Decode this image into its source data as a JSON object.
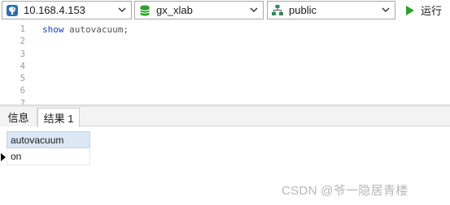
{
  "toolbar": {
    "connection": {
      "value": "10.168.4.153",
      "icon": "postgres-elephant-icon"
    },
    "database": {
      "value": "gx_xlab",
      "icon": "database-cylinder-icon"
    },
    "schema": {
      "value": "public",
      "icon": "schema-tree-icon"
    },
    "run_label": "运行",
    "run_dropdown": "·"
  },
  "editor": {
    "line_numbers": [
      "1",
      "2",
      "3",
      "4",
      "5",
      "6",
      "7"
    ],
    "code_line_1_keyword": "show",
    "code_line_1_rest": " autovacuum;"
  },
  "tabs": {
    "info_label": "信息",
    "result_label": "结果 1"
  },
  "result": {
    "columns": [
      "autovacuum"
    ],
    "rows": [
      [
        "on"
      ]
    ]
  },
  "watermark": "CSDN @爷一隐居青楼",
  "colors": {
    "keyword": "#1c3fb8",
    "header_bg": "#dbe7f5",
    "run_icon": "#2e9e2e",
    "db_icon": "#2e9e2e"
  }
}
